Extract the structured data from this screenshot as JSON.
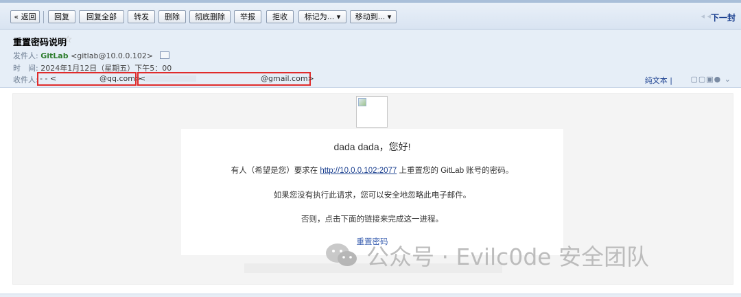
{
  "toolbar": {
    "back": "« 返回",
    "reply": "回复",
    "reply_all": "回复全部",
    "forward": "转发",
    "delete": "删除",
    "delete_permanently": "彻底删除",
    "report": "举报",
    "reject": "拒收",
    "mark_as": "标记为... ▾",
    "move_to": "移动到... ▾",
    "next": "下一封"
  },
  "header": {
    "subject": "重置密码说明",
    "star": "☆",
    "from_label": "发件人:",
    "from_name": "GitLab",
    "from_email": "<gitlab@10.0.0.102>",
    "time_label": "时　间:",
    "time_value": "2024年1月12日（星期五）下午5：00",
    "to_label": "收件人:",
    "to_1_prefix": "- - <",
    "to_1_suffix": "@qq.com>",
    "to_2_prefix": "<",
    "to_2_suffix": "@gmail.com>",
    "plain_text": "纯文本 |",
    "tool_icons": "▢▢▣● ⌄"
  },
  "body": {
    "greeting": "dada dada，您好!",
    "line1_before": "有人（希望是您）要求在 ",
    "line1_link": "http://10.0.0.102:2077",
    "line1_after": " 上重置您的 GitLab 账号的密码。",
    "line2": "如果您没有执行此请求，您可以安全地忽略此电子邮件。",
    "line3": "否则，点击下面的链接来完成这一进程。",
    "reset_link": "重置密码"
  },
  "watermark": {
    "text": "公众号 · Evilc0de 安全团队"
  },
  "colors": {
    "highlight_box": "#e02b2b",
    "link": "#1a3f8f",
    "sender_name": "#2e7d2e"
  }
}
